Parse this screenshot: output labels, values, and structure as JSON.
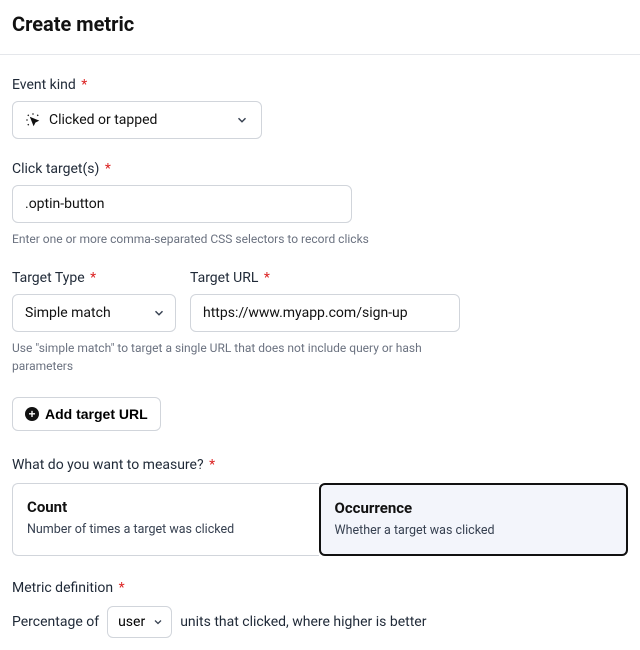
{
  "page": {
    "title": "Create metric"
  },
  "eventKind": {
    "label": "Event kind",
    "value": "Clicked or tapped"
  },
  "clickTargets": {
    "label": "Click target(s)",
    "value": ".optin-button",
    "hint": "Enter one or more comma-separated CSS selectors to record clicks"
  },
  "targetType": {
    "label": "Target Type",
    "value": "Simple match"
  },
  "targetUrl": {
    "label": "Target URL",
    "value": "https://www.myapp.com/sign-up"
  },
  "targetHint": "Use \"simple match\" to target a single URL that does not include query or hash parameters",
  "addTarget": {
    "label": "Add target URL"
  },
  "measure": {
    "label": "What do you want to measure?",
    "options": [
      {
        "title": "Count",
        "desc": "Number of times a target was clicked"
      },
      {
        "title": "Occurrence",
        "desc": "Whether a target was clicked"
      }
    ]
  },
  "metricDef": {
    "label": "Metric definition",
    "prefix": "Percentage of",
    "unit": "user",
    "suffix": "units that clicked, where higher is better"
  }
}
